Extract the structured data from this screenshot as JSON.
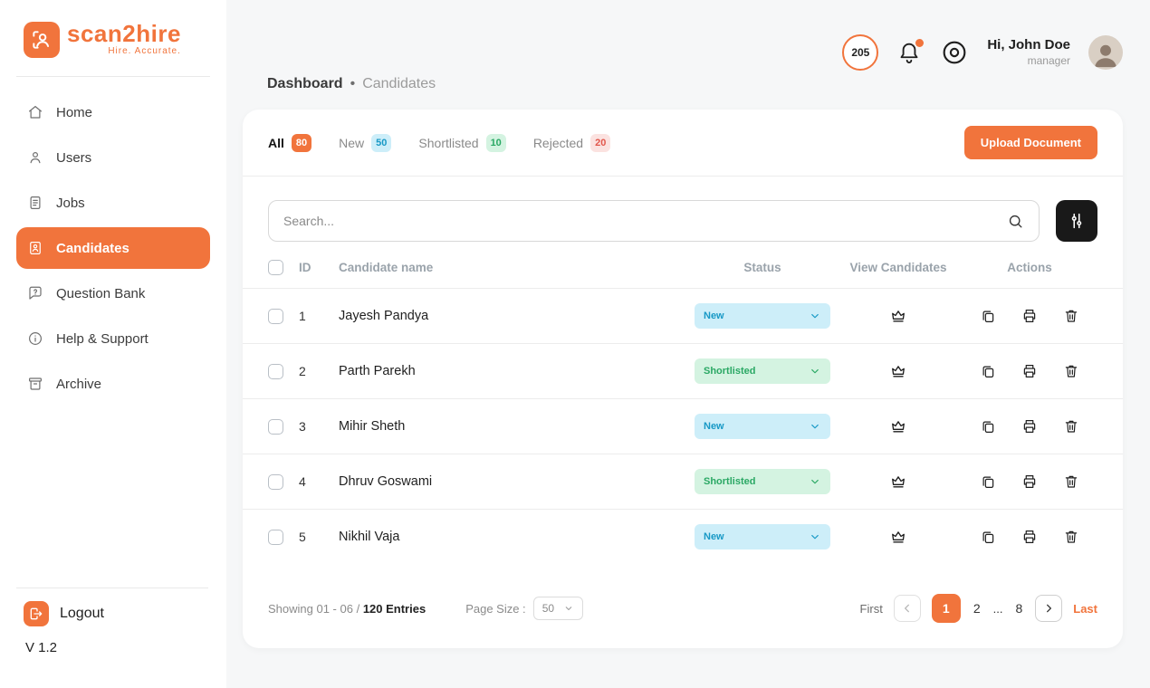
{
  "app": {
    "brand": "scan2hire",
    "tagline": "Hire. Accurate.",
    "version": "V 1.2"
  },
  "colors": {
    "accent": "#f1743c",
    "new_bg": "#cdeef9",
    "new_text": "#1899c6",
    "short_bg": "#d4f3e1",
    "short_text": "#2aa864",
    "rej_bg": "#fbe2e0",
    "rej_text": "#e2574c"
  },
  "sidebar": {
    "items": [
      {
        "label": "Home"
      },
      {
        "label": "Users"
      },
      {
        "label": "Jobs"
      },
      {
        "label": "Candidates"
      },
      {
        "label": "Question Bank"
      },
      {
        "label": "Help & Support"
      },
      {
        "label": "Archive"
      }
    ],
    "logout_label": "Logout"
  },
  "header": {
    "breadcrumb": [
      "Dashboard",
      "Candidates"
    ],
    "breadcrumb_separator": "•",
    "notification_count": "205",
    "greeting": "Hi, John Doe",
    "role": "manager"
  },
  "tabs": [
    {
      "label": "All",
      "count": "80"
    },
    {
      "label": "New",
      "count": "50"
    },
    {
      "label": "Shortlisted",
      "count": "10"
    },
    {
      "label": "Rejected",
      "count": "20"
    }
  ],
  "toolbar": {
    "upload_label": "Upload Document"
  },
  "search": {
    "placeholder": "Search..."
  },
  "table": {
    "headers": [
      "ID",
      "Candidate name",
      "Status",
      "View Candidates",
      "Actions"
    ],
    "rows": [
      {
        "id": "1",
        "name": "Jayesh Pandya",
        "status": "New"
      },
      {
        "id": "2",
        "name": "Parth Parekh",
        "status": "Shortlisted"
      },
      {
        "id": "3",
        "name": "Mihir Sheth",
        "status": "New"
      },
      {
        "id": "4",
        "name": "Dhruv Goswami",
        "status": "Shortlisted"
      },
      {
        "id": "5",
        "name": "Nikhil Vaja",
        "status": "New"
      }
    ]
  },
  "pagination": {
    "showing_prefix": "Showing 01 - 06 /",
    "showing_bold": "120 Entries",
    "page_size_label": "Page Size :",
    "page_size_value": "50",
    "first_label": "First",
    "last_label": "Last",
    "page_1": "1",
    "page_2": "2",
    "ellipsis": "...",
    "page_last": "8"
  }
}
